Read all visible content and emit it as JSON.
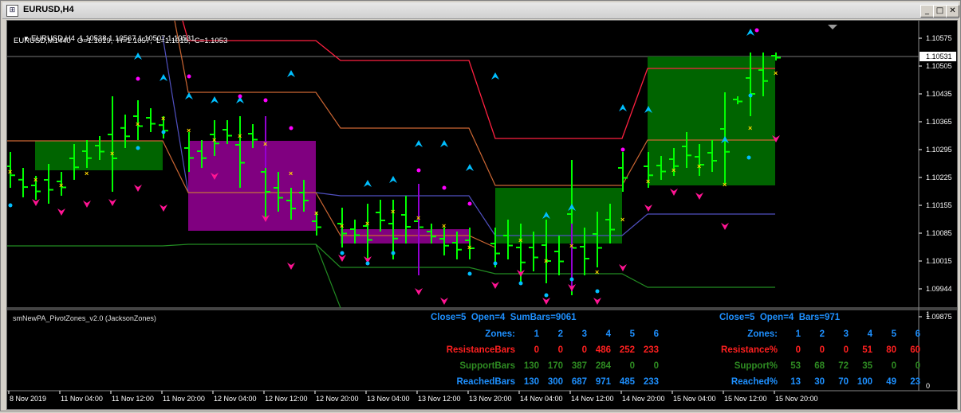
{
  "window": {
    "title": "EURUSD,H4"
  },
  "chart": {
    "info_line1": "EURUSD,H4  1.10538 1.10567 1.10507 1.10531",
    "info_line2": "EURUSD,M1440   O=1.1019,  H=1.1057,  L=1.1015,  C=1.1053",
    "price_axis": [
      "1.10575",
      "1.10505",
      "1.10435",
      "1.10365",
      "1.10295",
      "1.10225",
      "1.10155",
      "1.10085",
      "1.10015",
      "1.09944",
      "1.09875"
    ],
    "current_price": "1.10531",
    "time_axis": [
      "8 Nov 2019",
      "11 Nov 04:00",
      "11 Nov 12:00",
      "11 Nov 20:00",
      "12 Nov 04:00",
      "12 Nov 12:00",
      "12 Nov 20:00",
      "13 Nov 04:00",
      "13 Nov 12:00",
      "13 Nov 20:00",
      "14 Nov 04:00",
      "14 Nov 12:00",
      "14 Nov 20:00",
      "15 Nov 04:00",
      "15 Nov 12:00",
      "15 Nov 20:00"
    ],
    "indicator_scale_top": "1",
    "indicator_scale_bottom": "0",
    "colors": {
      "support_zone": "#006400",
      "resistance_zone": "#800080",
      "candle": "#00ff00",
      "up_arrow": "#00bfff",
      "down_arrow": "#ff1493",
      "resistance_line": "#ff2040",
      "pivot_line": "#cc6633",
      "mid_line": "#5050c0",
      "support_line": "#228b22"
    }
  },
  "indicator": {
    "name": "smNewPA_PivotZones_v2.0 (JacksonZones)",
    "left": {
      "header": "Close=5  Open=4  SumBars=9061",
      "zones_label": "Zones:",
      "zones": [
        "1",
        "2",
        "3",
        "4",
        "5",
        "6"
      ],
      "resistance_label": "ResistanceBars",
      "resistance": [
        "0",
        "0",
        "0",
        "486",
        "252",
        "233"
      ],
      "support_label": "SupportBars",
      "support": [
        "130",
        "170",
        "387",
        "284",
        "0",
        "0"
      ],
      "reached_label": "ReachedBars",
      "reached": [
        "130",
        "300",
        "687",
        "971",
        "485",
        "233"
      ]
    },
    "right": {
      "header": "Close=5  Open=4  Bars=971",
      "zones_label": "Zones:",
      "zones": [
        "1",
        "2",
        "3",
        "4",
        "5",
        "6"
      ],
      "resistance_label": "Resistance%",
      "resistance": [
        "0",
        "0",
        "0",
        "51",
        "80",
        "60"
      ],
      "support_label": "Support%",
      "support": [
        "53",
        "68",
        "72",
        "35",
        "0",
        "0"
      ],
      "reached_label": "Reached%",
      "reached": [
        "13",
        "30",
        "70",
        "100",
        "49",
        "23"
      ]
    }
  }
}
